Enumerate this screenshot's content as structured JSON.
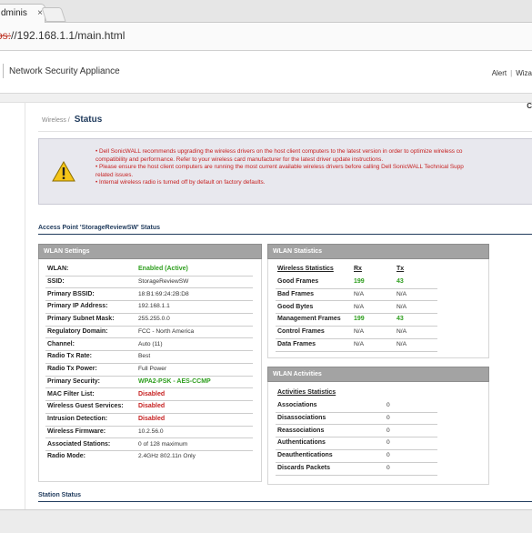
{
  "browser": {
    "tab_title": "dminis",
    "tab_close": "×",
    "url_proto": "ps:",
    "url_rest": "//192.168.1.1/main.html"
  },
  "header": {
    "app_title": "Network Security Appliance",
    "alert": "Alert",
    "separator": "|",
    "wizard": "Wiza"
  },
  "corner_letter": "C",
  "breadcrumb": {
    "parent": "Wireless /",
    "title": "Status"
  },
  "warning": {
    "lines": [
      "• Dell SonicWALL recommends upgrading the wireless drivers on the host client computers to the latest version in order to optimize wireless co",
      "compatibility and performance. Refer to your wireless card manufacturer for the latest driver update instructions.",
      "• Please ensure the host client computers are running the most current available wireless drivers before calling Dell SonicWALL Technical Supp",
      "related issues.",
      "• Internal wireless radio is turned off by default on factory defaults."
    ]
  },
  "ap_status_title": "Access Point 'StorageReviewSW' Status",
  "wlan_settings": {
    "title": "WLAN Settings",
    "rows": [
      {
        "label": "WLAN:",
        "value": "Enabled (Active)",
        "style": "green"
      },
      {
        "label": "SSID:",
        "value": "StorageReviewSW",
        "style": "plain"
      },
      {
        "label": "Primary BSSID:",
        "value": "18:B1:69:24:2B:D8",
        "style": "plain"
      },
      {
        "label": "Primary IP Address:",
        "value": "192.168.1.1",
        "style": "plain"
      },
      {
        "label": "Primary Subnet Mask:",
        "value": "255.255.0.0",
        "style": "plain"
      },
      {
        "label": "Regulatory Domain:",
        "value": "FCC - North America",
        "style": "plain"
      },
      {
        "label": "Channel:",
        "value": "Auto (11)",
        "style": "plain"
      },
      {
        "label": "Radio Tx Rate:",
        "value": "Best",
        "style": "plain"
      },
      {
        "label": "Radio Tx Power:",
        "value": "Full Power",
        "style": "plain"
      },
      {
        "label": "Primary Security:",
        "value": "WPA2-PSK - AES-CCMP",
        "style": "green"
      },
      {
        "label": "MAC Filter List:",
        "value": "Disabled",
        "style": "red"
      },
      {
        "label": "Wireless Guest Services:",
        "value": "Disabled",
        "style": "red"
      },
      {
        "label": "Intrusion Detection:",
        "value": "Disabled",
        "style": "red"
      },
      {
        "label": "Wireless Firmware:",
        "value": "10.2.56.0",
        "style": "plain"
      },
      {
        "label": "Associated Stations:",
        "value": "0 of 128 maximum",
        "style": "plain"
      },
      {
        "label": "Radio Mode:",
        "value": "2.4GHz 802.11n Only",
        "style": "plain"
      }
    ]
  },
  "wlan_statistics": {
    "title": "WLAN Statistics",
    "headers": [
      "Wireless Statistics",
      "Rx",
      "Tx"
    ],
    "rows": [
      {
        "name": "Good Frames",
        "rx": "199",
        "tx": "43",
        "rx_style": "green",
        "tx_style": "green"
      },
      {
        "name": "Bad Frames",
        "rx": "N/A",
        "tx": "N/A",
        "rx_style": "plain",
        "tx_style": "plain"
      },
      {
        "name": "Good Bytes",
        "rx": "N/A",
        "tx": "N/A",
        "rx_style": "plain",
        "tx_style": "plain"
      },
      {
        "name": "Management Frames",
        "rx": "199",
        "tx": "43",
        "rx_style": "green",
        "tx_style": "green"
      },
      {
        "name": "Control Frames",
        "rx": "N/A",
        "tx": "N/A",
        "rx_style": "plain",
        "tx_style": "plain"
      },
      {
        "name": "Data Frames",
        "rx": "N/A",
        "tx": "N/A",
        "rx_style": "plain",
        "tx_style": "plain"
      }
    ]
  },
  "wlan_activities": {
    "title": "WLAN Activities",
    "header": "Activities Statistics",
    "rows": [
      {
        "name": "Associations",
        "value": "0"
      },
      {
        "name": "Disassociations",
        "value": "0"
      },
      {
        "name": "Reassociations",
        "value": "0"
      },
      {
        "name": "Authentications",
        "value": "0"
      },
      {
        "name": "Deauthentications",
        "value": "0"
      },
      {
        "name": "Discards Packets",
        "value": "0"
      }
    ]
  },
  "station_status_title": "Station Status",
  "colors": {
    "green": "#2e9e1e",
    "red": "#c62020",
    "panel_header": "#a3a3a3",
    "heading_blue": "#1f3a5c"
  }
}
